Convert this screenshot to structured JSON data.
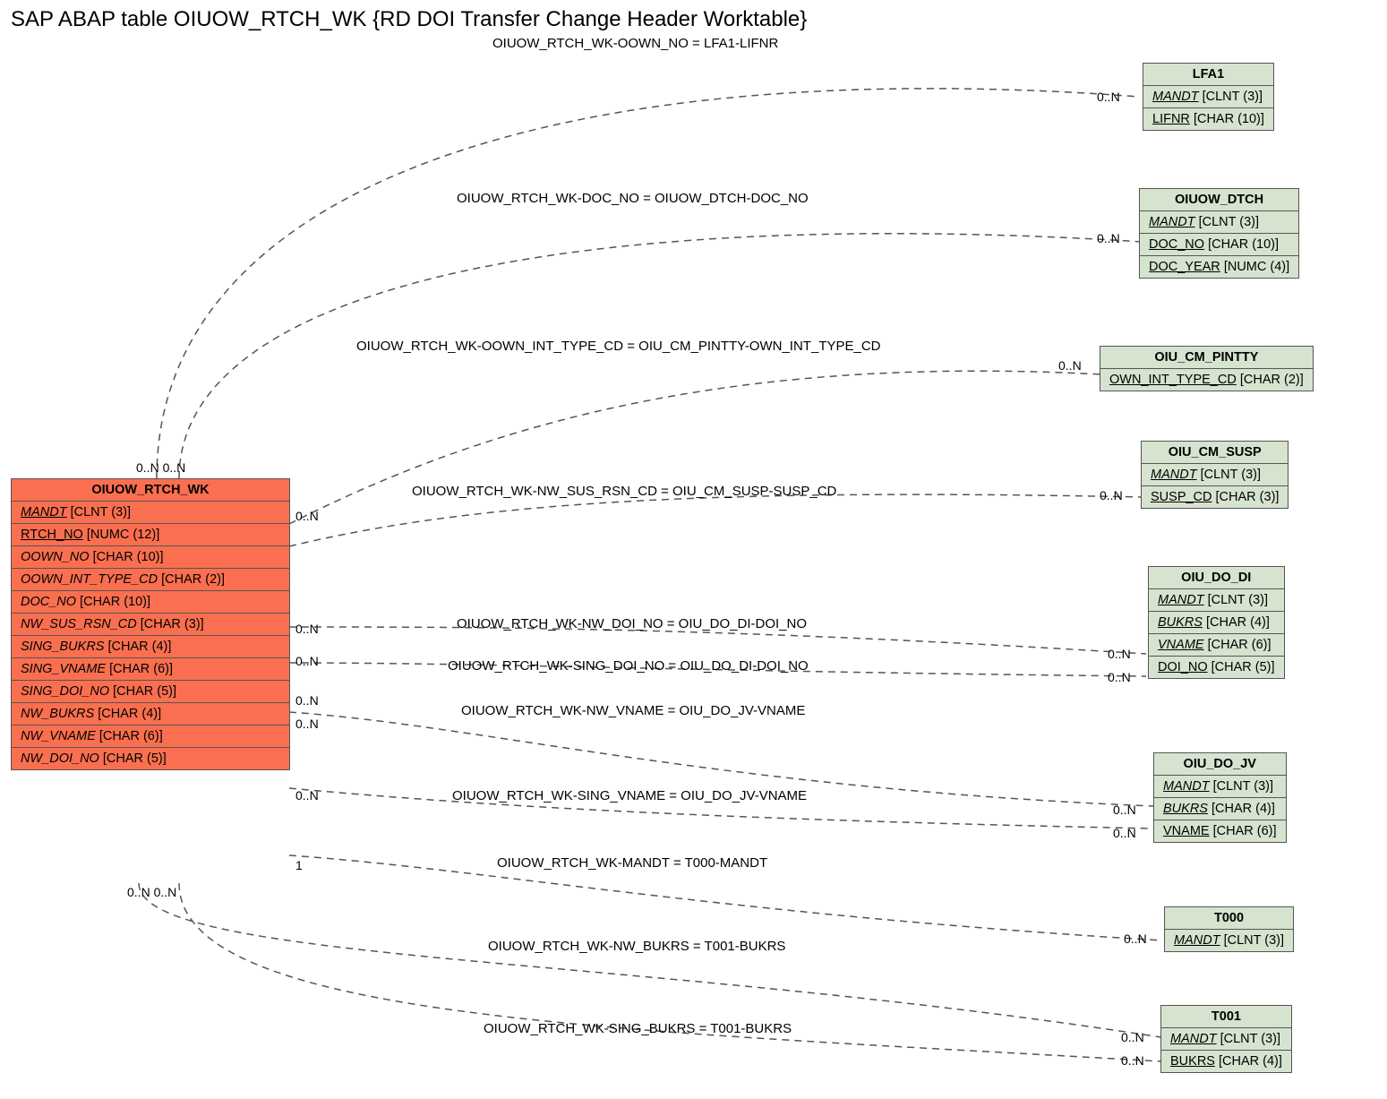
{
  "title": "SAP ABAP table OIUOW_RTCH_WK {RD DOI Transfer Change Header Worktable}",
  "entities": {
    "primary": {
      "name": "OIUOW_RTCH_WK",
      "fields": [
        {
          "name": "MANDT",
          "type": "[CLNT (3)]",
          "key": true
        },
        {
          "name": "RTCH_NO",
          "type": "[NUMC (12)]",
          "ul": true
        },
        {
          "name": "OOWN_NO",
          "type": "[CHAR (10)]",
          "it": true
        },
        {
          "name": "OOWN_INT_TYPE_CD",
          "type": "[CHAR (2)]",
          "it": true
        },
        {
          "name": "DOC_NO",
          "type": "[CHAR (10)]",
          "it": true
        },
        {
          "name": "NW_SUS_RSN_CD",
          "type": "[CHAR (3)]",
          "it": true
        },
        {
          "name": "SING_BUKRS",
          "type": "[CHAR (4)]",
          "it": true
        },
        {
          "name": "SING_VNAME",
          "type": "[CHAR (6)]",
          "it": true
        },
        {
          "name": "SING_DOI_NO",
          "type": "[CHAR (5)]",
          "it": true
        },
        {
          "name": "NW_BUKRS",
          "type": "[CHAR (4)]",
          "it": true
        },
        {
          "name": "NW_VNAME",
          "type": "[CHAR (6)]",
          "it": true
        },
        {
          "name": "NW_DOI_NO",
          "type": "[CHAR (5)]",
          "it": true
        }
      ]
    },
    "lfa1": {
      "name": "LFA1",
      "fields": [
        {
          "name": "MANDT",
          "type": "[CLNT (3)]",
          "key": true
        },
        {
          "name": "LIFNR",
          "type": "[CHAR (10)]",
          "ul": true
        }
      ]
    },
    "dtch": {
      "name": "OIUOW_DTCH",
      "fields": [
        {
          "name": "MANDT",
          "type": "[CLNT (3)]",
          "key": true
        },
        {
          "name": "DOC_NO",
          "type": "[CHAR (10)]",
          "ul": true
        },
        {
          "name": "DOC_YEAR",
          "type": "[NUMC (4)]",
          "ul": true
        }
      ]
    },
    "pintty": {
      "name": "OIU_CM_PINTTY",
      "fields": [
        {
          "name": "OWN_INT_TYPE_CD",
          "type": "[CHAR (2)]",
          "ul": true
        }
      ]
    },
    "susp": {
      "name": "OIU_CM_SUSP",
      "fields": [
        {
          "name": "MANDT",
          "type": "[CLNT (3)]",
          "key": true
        },
        {
          "name": "SUSP_CD",
          "type": "[CHAR (3)]",
          "ul": true
        }
      ]
    },
    "dodi": {
      "name": "OIU_DO_DI",
      "fields": [
        {
          "name": "MANDT",
          "type": "[CLNT (3)]",
          "key": true
        },
        {
          "name": "BUKRS",
          "type": "[CHAR (4)]",
          "key": true
        },
        {
          "name": "VNAME",
          "type": "[CHAR (6)]",
          "key": true
        },
        {
          "name": "DOI_NO",
          "type": "[CHAR (5)]",
          "ul": true
        }
      ]
    },
    "dojv": {
      "name": "OIU_DO_JV",
      "fields": [
        {
          "name": "MANDT",
          "type": "[CLNT (3)]",
          "key": true
        },
        {
          "name": "BUKRS",
          "type": "[CHAR (4)]",
          "key": true
        },
        {
          "name": "VNAME",
          "type": "[CHAR (6)]",
          "ul": true
        }
      ]
    },
    "t000": {
      "name": "T000",
      "fields": [
        {
          "name": "MANDT",
          "type": "[CLNT (3)]",
          "key": true
        }
      ]
    },
    "t001": {
      "name": "T001",
      "fields": [
        {
          "name": "MANDT",
          "type": "[CLNT (3)]",
          "key": true
        },
        {
          "name": "BUKRS",
          "type": "[CHAR (4)]",
          "ul": true
        }
      ]
    }
  },
  "relations": [
    {
      "label": "OIUOW_RTCH_WK-OOWN_NO = LFA1-LIFNR"
    },
    {
      "label": "OIUOW_RTCH_WK-DOC_NO = OIUOW_DTCH-DOC_NO"
    },
    {
      "label": "OIUOW_RTCH_WK-OOWN_INT_TYPE_CD = OIU_CM_PINTTY-OWN_INT_TYPE_CD"
    },
    {
      "label": "OIUOW_RTCH_WK-NW_SUS_RSN_CD = OIU_CM_SUSP-SUSP_CD"
    },
    {
      "label": "OIUOW_RTCH_WK-NW_DOI_NO = OIU_DO_DI-DOI_NO"
    },
    {
      "label": "OIUOW_RTCH_WK-SING_DOI_NO = OIU_DO_DI-DOI_NO"
    },
    {
      "label": "OIUOW_RTCH_WK-NW_VNAME = OIU_DO_JV-VNAME"
    },
    {
      "label": "OIUOW_RTCH_WK-SING_VNAME = OIU_DO_JV-VNAME"
    },
    {
      "label": "OIUOW_RTCH_WK-MANDT = T000-MANDT"
    },
    {
      "label": "OIUOW_RTCH_WK-NW_BUKRS = T001-BUKRS"
    },
    {
      "label": "OIUOW_RTCH_WK-SING_BUKRS = T001-BUKRS"
    }
  ],
  "cards": {
    "top_left_pair": "0..N 0..N",
    "bot_left_pair": "0..N  0..N",
    "r0n": "0..N",
    "r1": "1"
  }
}
